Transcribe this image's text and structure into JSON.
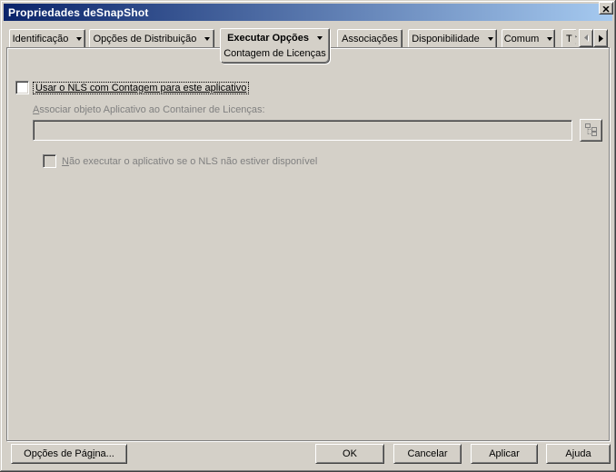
{
  "titlebar": {
    "title": "Propriedades deSnapShot"
  },
  "icons": {
    "close": "close-x",
    "dropdown_arrow": "black down triangle",
    "scroll_left": "left triangle (disabled)",
    "scroll_right": "right triangle",
    "browse": "object-tree-browse"
  },
  "tabs": {
    "identification": "Identificação",
    "distribution_options": "Opções de Distribuição",
    "run_options": "Executar Opções",
    "run_options_subpage": "Contagem de Licenças",
    "associations": "Associações",
    "availability": "Disponibilidade",
    "common": "Comum",
    "clipped": "T"
  },
  "content": {
    "use_nls_label": "Usar o NLS com Contagem para este aplicativo",
    "use_nls_checked": false,
    "associate_label_accel": "A",
    "associate_label_rest": "ssociar objeto Aplicativo ao Container de Licenças:",
    "container_value": "",
    "no_run_label_accel": "N",
    "no_run_label_rest": "ão executar o aplicativo se o NLS não estiver disponível",
    "no_run_checked": false
  },
  "buttons": {
    "page_options_pre": "Opções de Pág",
    "page_options_accel": "i",
    "page_options_post": "na...",
    "ok": "OK",
    "cancel": "Cancelar",
    "apply": "Aplicar",
    "help": "Ajuda"
  },
  "colors": {
    "dialog_bg": "#d4d0c8",
    "title_gradient_start": "#0a246a",
    "title_gradient_end": "#a6caf0",
    "disabled_text": "#808080"
  }
}
